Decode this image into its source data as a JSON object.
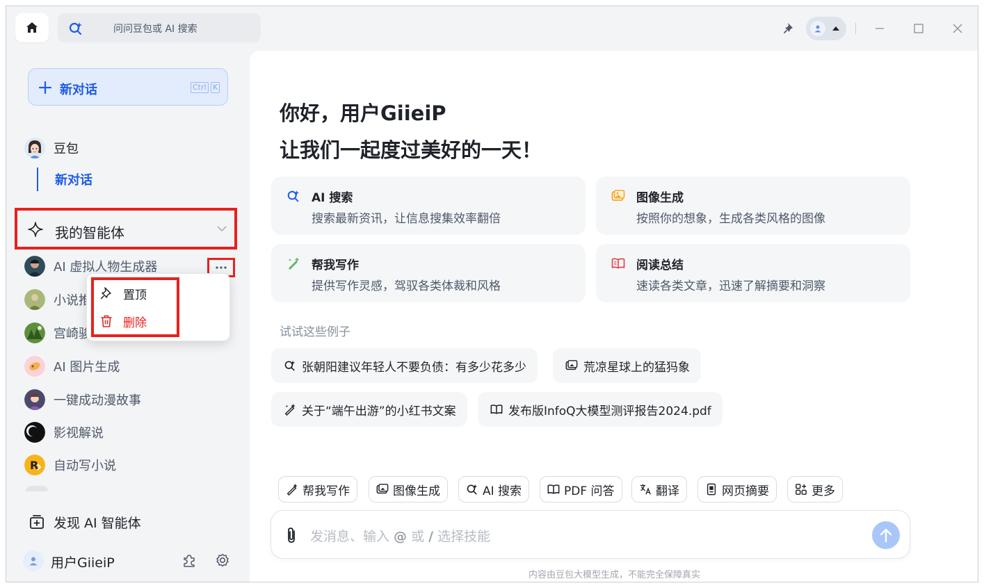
{
  "topbar": {
    "search_placeholder": "问问豆包或 AI 搜索"
  },
  "sidebar": {
    "new_chat_label": "新对话",
    "shortcut_keys": [
      "Ctrl",
      "K"
    ],
    "bot_name": "豆包",
    "current_chat": "新对话",
    "agents_section": "我的智能体",
    "agents": [
      {
        "name": "AI 虚拟人物生成器"
      },
      {
        "name": "小说推"
      },
      {
        "name": "宫崎骏"
      },
      {
        "name": "AI 图片生成"
      },
      {
        "name": "一键成动漫故事"
      },
      {
        "name": "影视解说"
      },
      {
        "name": "自动写小说"
      }
    ],
    "discover_label": "发现 AI 智能体",
    "username": "用户GiieiP"
  },
  "context_menu": {
    "items": [
      {
        "label": "置顶",
        "icon": "pin-icon",
        "color": "#1f2329"
      },
      {
        "label": "删除",
        "icon": "trash-icon",
        "color": "#e8211c"
      }
    ]
  },
  "main": {
    "greeting_line1": "你好，用户GiieiP",
    "greeting_line2": "让我们一起度过美好的一天！",
    "feature_cards": [
      {
        "title": "AI 搜索",
        "desc": "搜索最新资讯，让信息搜集效率翻倍",
        "icon": "ai-search-icon"
      },
      {
        "title": "图像生成",
        "desc": "按照你的想象，生成各类风格的图像",
        "icon": "image-gen-icon"
      },
      {
        "title": "帮我写作",
        "desc": "提供写作灵感，驾驭各类体裁和风格",
        "icon": "writing-icon"
      },
      {
        "title": "阅读总结",
        "desc": "速读各类文章，迅速了解摘要和洞察",
        "icon": "reading-icon"
      }
    ],
    "examples_label": "试试这些例子",
    "examples": [
      {
        "text": "张朝阳建议年轻人不要负债：有多少花多少",
        "icon": "ai-search-icon"
      },
      {
        "text": "荒凉星球上的猛犸象",
        "icon": "image-icon"
      },
      {
        "text": "关于“端午出游”的小红书文案",
        "icon": "writing-icon"
      },
      {
        "text": "发布版InfoQ大模型测评报告2024.pdf",
        "icon": "book-icon"
      }
    ],
    "skills": [
      {
        "label": "帮我写作",
        "icon": "writing-icon"
      },
      {
        "label": "图像生成",
        "icon": "image-icon"
      },
      {
        "label": "AI 搜索",
        "icon": "ai-search-icon"
      },
      {
        "label": "PDF 问答",
        "icon": "book-icon"
      },
      {
        "label": "翻译",
        "icon": "translate-icon"
      },
      {
        "label": "网页摘要",
        "icon": "webpage-icon"
      },
      {
        "label": "更多",
        "icon": "more-grid-icon"
      }
    ],
    "composer": {
      "placeholder_parts": [
        "发消息、输入 ",
        "@",
        " 或 ",
        "/",
        " 选择技能"
      ]
    },
    "disclaimer": "内容由豆包大模型生成，不能完全保障真实"
  },
  "colors": {
    "accent": "#1e5be6",
    "highlight_border": "#e8211c",
    "send_button": "#a9c6f8"
  }
}
